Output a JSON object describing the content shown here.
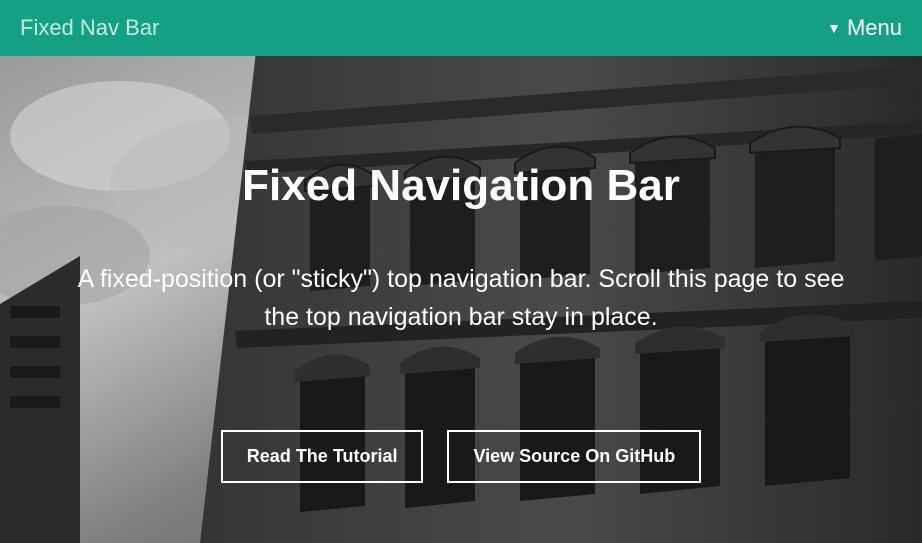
{
  "navbar": {
    "brand": "Fixed Nav Bar",
    "menu_label": "Menu"
  },
  "hero": {
    "title": "Fixed Navigation Bar",
    "subtitle": "A fixed-position (or \"sticky\") top navigation bar. Scroll this page to see the top navigation bar stay in place.",
    "buttons": {
      "tutorial": "Read The Tutorial",
      "github": "View Source On GitHub"
    }
  },
  "colors": {
    "navbar_bg": "#14a085",
    "text_light": "#ffffff"
  }
}
